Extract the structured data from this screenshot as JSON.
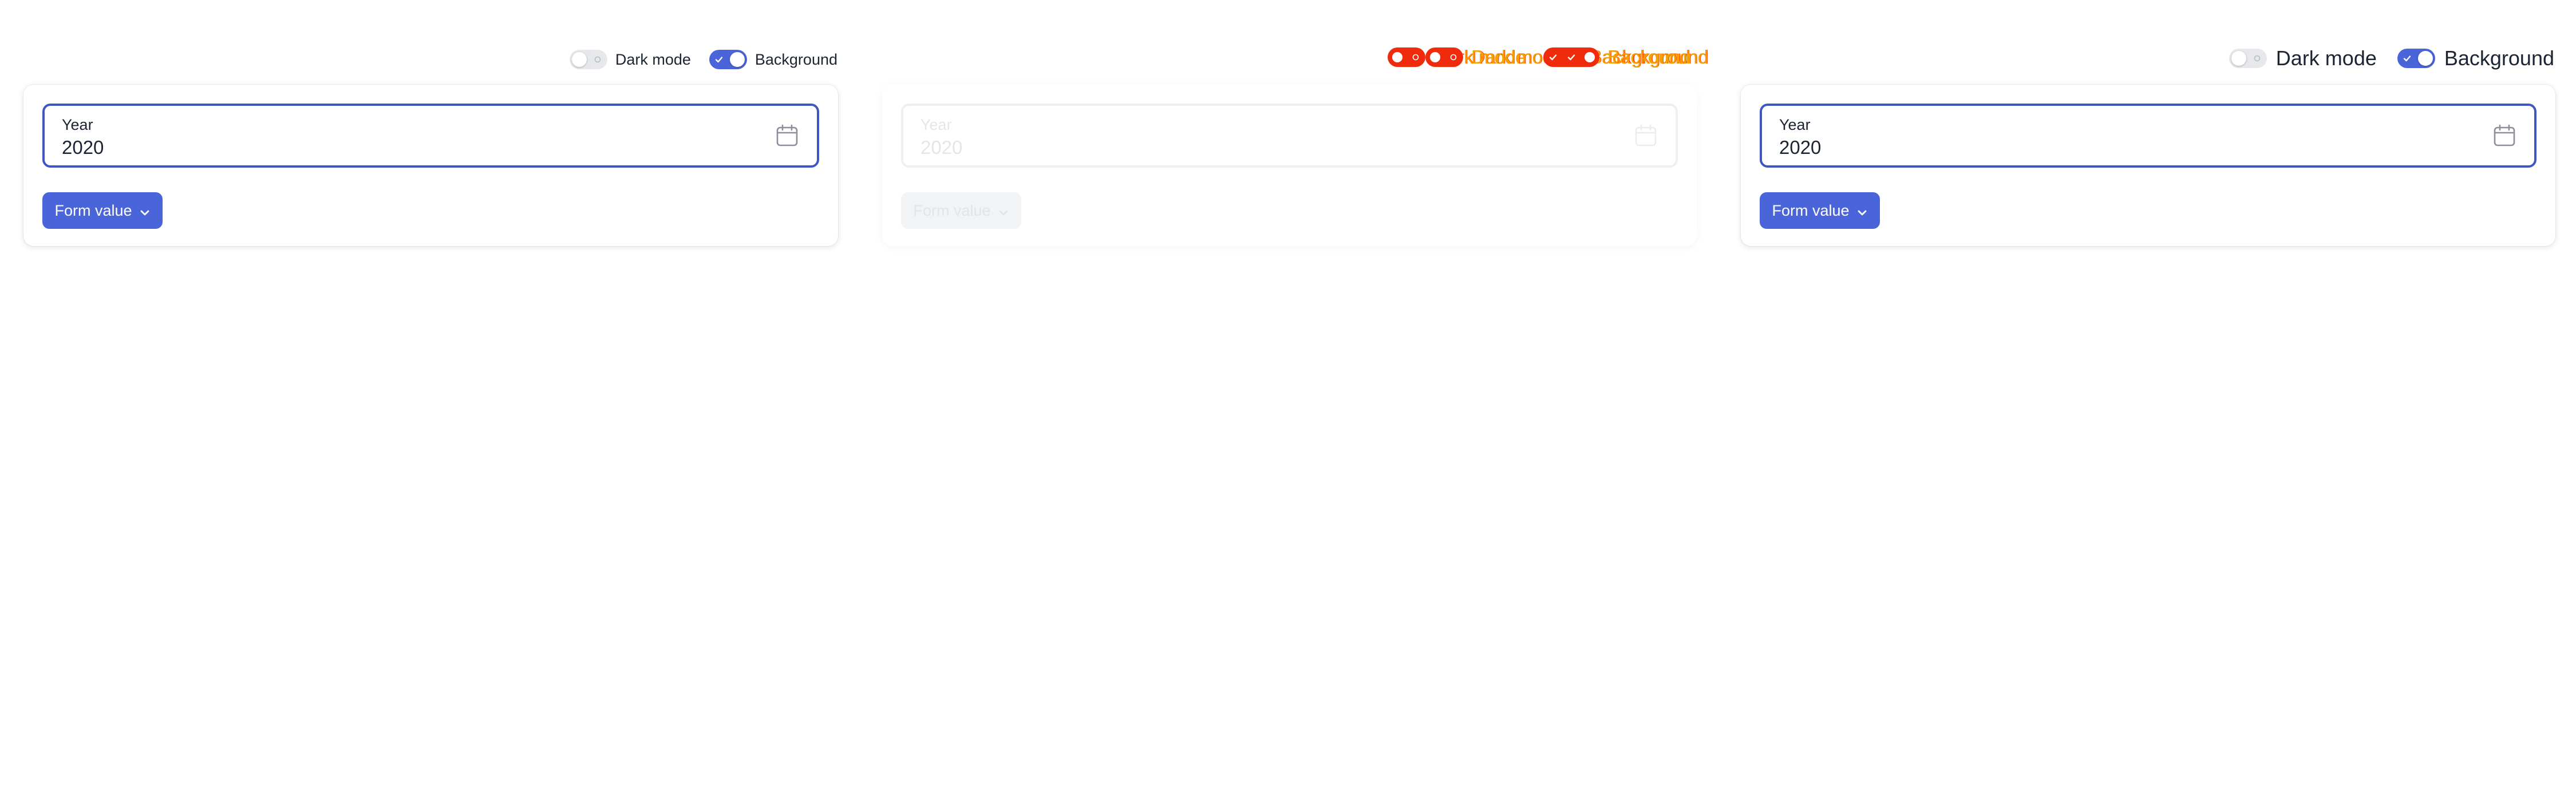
{
  "toggles": {
    "dark_mode_label": "Dark mode",
    "background_label": "Background",
    "dark_mode_on": false,
    "background_on": true
  },
  "field": {
    "label": "Year",
    "value": "2020"
  },
  "form_button": {
    "label": "Form value"
  },
  "icons": {
    "calendar": "calendar-icon",
    "chevron": "chevron-down-icon",
    "check": "check-icon"
  },
  "colors": {
    "accent": "#4a64d9",
    "focus_border": "#3e55c4",
    "switch_off": "#e6e8ec",
    "debug_red": "#f02a0c",
    "debug_orange": "#f7a100",
    "text": "#1c2333"
  }
}
